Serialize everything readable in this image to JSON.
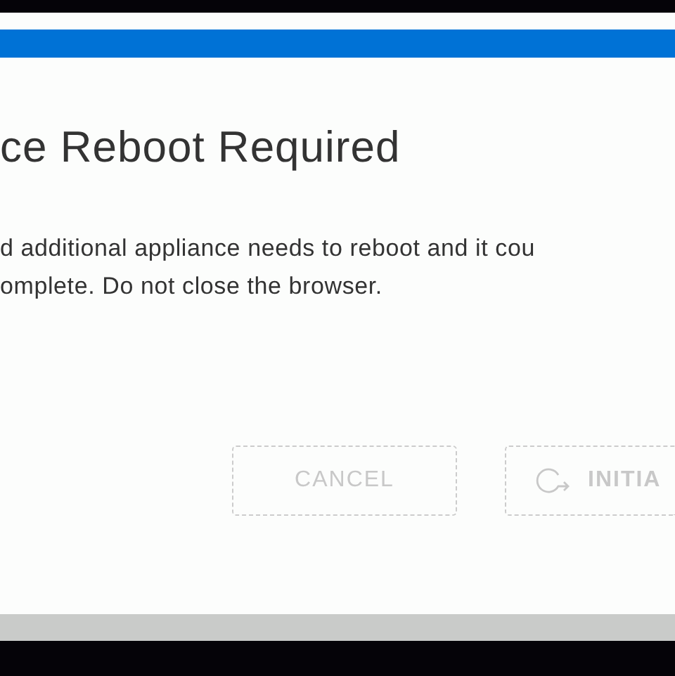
{
  "dialog": {
    "title": "ce Reboot Required",
    "message_lines": [
      "d additional appliance needs to reboot and it cou",
      "omplete. Do not close the browser."
    ],
    "buttons": [
      {
        "kind": "text",
        "label": "CANCEL",
        "disabled": true
      },
      {
        "kind": "icon",
        "label": "INITIA",
        "disabled": true
      }
    ]
  }
}
